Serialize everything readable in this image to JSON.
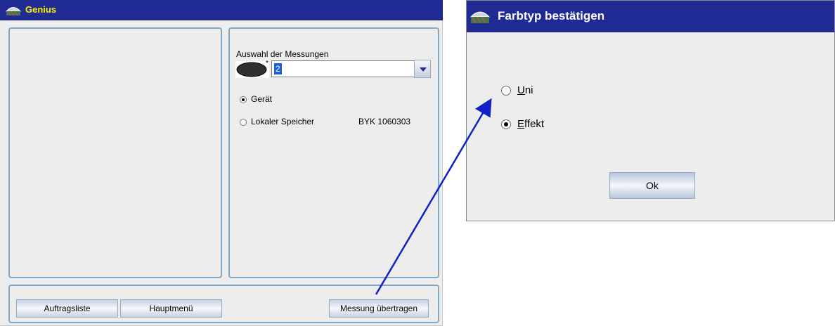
{
  "main_window": {
    "title": "Genius",
    "measurement_selection": {
      "label": "Auswahl der Messungen",
      "asterisk": "*",
      "combo_value": "2"
    },
    "source_options": [
      {
        "label": "Gerät",
        "checked": true
      },
      {
        "label": "Lokaler Speicher",
        "checked": false
      }
    ],
    "device_id": "BYK 1060303",
    "buttons": {
      "order_list": "Auftragsliste",
      "main_menu": "Hauptmenü",
      "transfer_measurement": "Messung übertragen"
    }
  },
  "dialog": {
    "title": "Farbtyp bestätigen",
    "options": [
      {
        "label": "Uni",
        "mnemonic": "U",
        "rest": "ni",
        "checked": false
      },
      {
        "label": "Effekt",
        "mnemonic": "E",
        "rest": "ffekt",
        "checked": true
      }
    ],
    "ok_label": "Ok"
  },
  "colors": {
    "titlebar": "#1f2a93",
    "main_title_text": "#fff200",
    "panel_border": "#7fa9c7",
    "window_background": "#ededed",
    "arrow": "#1220c8"
  },
  "icons": {
    "app_icon": "app-logo-icon",
    "combo_dropdown": "chevron-down-icon",
    "measurement_shape": "ellipse-icon"
  }
}
